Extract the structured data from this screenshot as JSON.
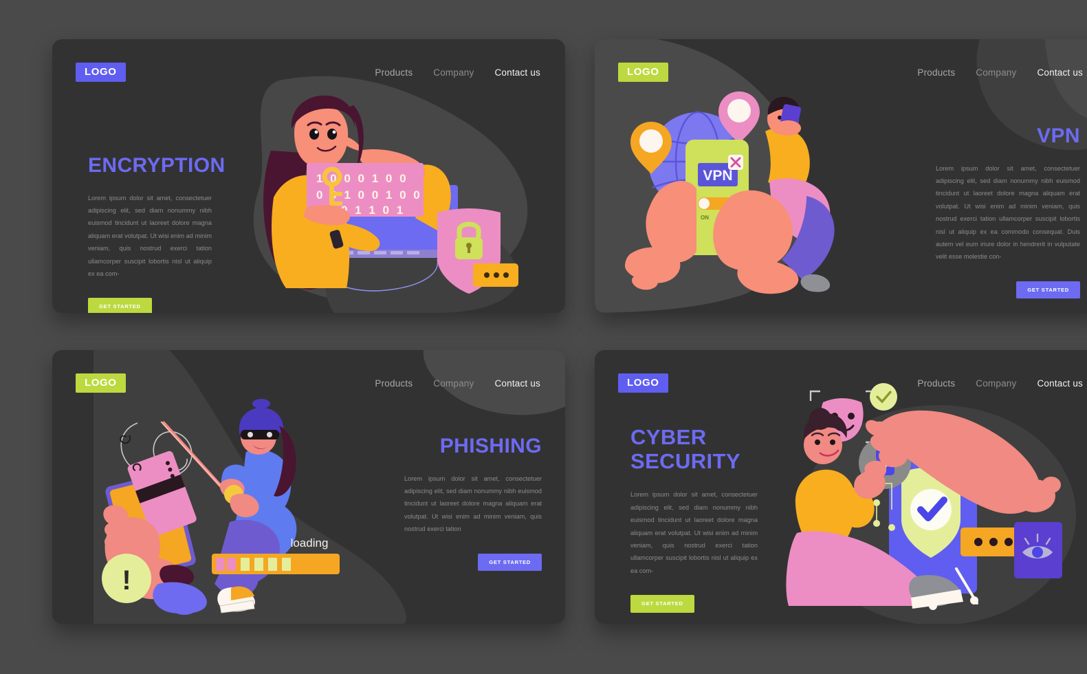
{
  "meta": {
    "background_color": "#4a4a4a",
    "panel_color": "#333232",
    "blob_color": "#474747",
    "accent_purple": "#6c6bf2",
    "accent_green": "#bcd93f"
  },
  "nav": {
    "links": [
      "Products",
      "Company",
      "Contact us"
    ],
    "logo_label": "LOGO"
  },
  "panels": [
    {
      "id": "encryption",
      "logo_label": "LOGO",
      "logo_color": "purple",
      "title": "ENCRYPTION",
      "body": "Lorem ipsum dolor sit amet, consectetuer adipiscing elit, sed diam nonummy nibh euismod tincidunt ut laoreet dolore magna aliquam erat volutpat. Ut wisi enim ad minim veniam, quis nostrud exerci tation ullamcorper suscipit lobortis nisl ut aliquip ex ea com-",
      "cta_label": "GET STARTED",
      "cta_color": "green",
      "align": "left",
      "art": {
        "name": "encryption-illustration",
        "binary_rows": [
          "1 0  0 0 1 0 0",
          "0 0 1 0 0 1 0 0",
          "0 1 1 0 1"
        ],
        "elements": [
          "woman",
          "laptop",
          "binary-card",
          "key-icon",
          "padlock-shield",
          "chat-bubble",
          "cable"
        ]
      }
    },
    {
      "id": "vpn",
      "logo_label": "LOGO",
      "logo_color": "green",
      "title": "VPN",
      "body": "Lorem ipsum dolor sit amet, consectetuer adipiscing elit, sed diam nonummy nibh euismod tincidunt ut laoreet dolore magna aliquam erat volutpat. Ut wisi enim ad minim veniam, quis nostrud exerci tation ullamcorper suscipit lobortis nisl ut aliquip ex ea commodo consequat. Duis autem vel eum iriure dolor in hendrerit in vulputate velit esse molestie con-",
      "cta_label": "GET STARTED",
      "cta_color": "purple",
      "align": "right",
      "art": {
        "name": "vpn-illustration",
        "phone_badge": "VPN",
        "toggle_label": "ON",
        "elements": [
          "globe",
          "location-pin-pink",
          "location-pin-orange",
          "hands",
          "phone",
          "man-with-phone",
          "close-x"
        ]
      }
    },
    {
      "id": "phishing",
      "logo_label": "LOGO",
      "logo_color": "green",
      "title": "PHISHING",
      "body": "Lorem ipsum dolor sit amet, consectetuer adipiscing elit, sed diam nonummy nibh euismod tincidunt ut laoreet dolore magna aliquam erat volutpat. Ut wisi enim ad minim veniam, quis nostrud exerci tation",
      "cta_label": "GET STARTED",
      "cta_color": "purple",
      "align": "right",
      "art": {
        "name": "phishing-illustration",
        "progress_label": "loading",
        "warning_glyph": "!",
        "elements": [
          "hand-with-phone",
          "credit-card",
          "fishing-rod",
          "hacker",
          "progress-bar",
          "warning-circle"
        ]
      }
    },
    {
      "id": "cyber-security",
      "logo_label": "LOGO",
      "logo_color": "purple",
      "title": "CYBER\nSECURITY",
      "title_lines": [
        "CYBER",
        "SECURITY"
      ],
      "body": "Lorem ipsum dolor sit amet, consectetuer adipiscing elit, sed diam nonummy nibh euismod tincidunt ut laoreet dolore magna aliquam erat volutpat. Ut wisi enim ad minim veniam, quis nostrud exerci tation ullamcorper suscipit lobortis nisl ut aliquip ex ea com-",
      "cta_label": "GET STARTED",
      "cta_color": "green",
      "align": "left",
      "art": {
        "name": "cyber-security-illustration",
        "elements": [
          "woman-seated",
          "fingerprint-lock",
          "mask-icon",
          "check-badge",
          "phone",
          "shield-check",
          "password-dots",
          "eye-icon",
          "big-hand"
        ]
      }
    }
  ]
}
